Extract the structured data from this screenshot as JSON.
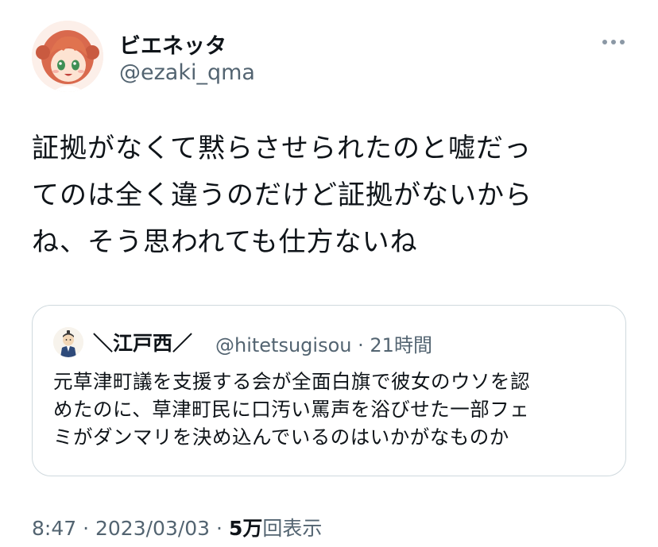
{
  "author": {
    "display_name": "ビエネッタ",
    "handle": "@ezaki_qma"
  },
  "tweet": {
    "text_lines": [
      "証拠がなくて黙らさせられたのと嘘だっ",
      "てのは全く違うのだけど証拠がないから",
      "ね、そう思われても仕方ないね"
    ]
  },
  "quoted_tweet": {
    "display_name": "＼江戸西／",
    "handle": "@hitetsugisou",
    "separator": "·",
    "time_ago": "21時間",
    "text_lines": [
      "元草津町議を支援する会が全面白旗で彼女のウソを認",
      "めたのに、草津町民に口汚い罵声を浴びせた一部フェ",
      "ミがダンマリを決め込んでいるのはいかがなものか"
    ]
  },
  "meta": {
    "time": "8:47",
    "separator": "·",
    "date": "2023/03/03",
    "views_count": "5万",
    "views_label": "回表示"
  },
  "icons": {
    "more": "more-dots-icon"
  },
  "colors": {
    "text_primary": "#0f1419",
    "text_secondary": "#536471",
    "border": "#cfd9de"
  }
}
